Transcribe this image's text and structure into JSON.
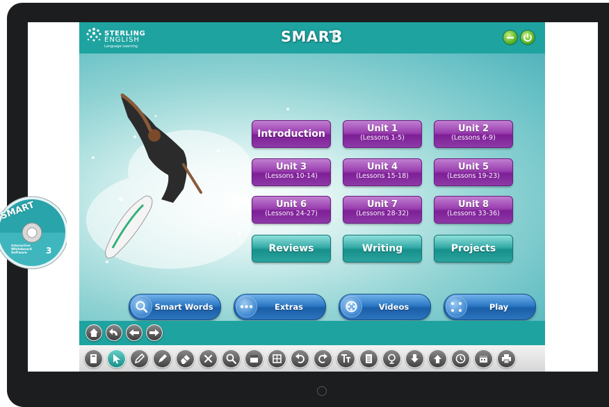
{
  "brand": {
    "name": "STERLING",
    "sub": "ENGLISH",
    "tagline": "Language Learning",
    "title": "SMART",
    "title_number": "3"
  },
  "menu": [
    {
      "title": "Introduction",
      "sub": ""
    },
    {
      "title": "Unit 1",
      "sub": "(Lessons 1-5)"
    },
    {
      "title": "Unit 2",
      "sub": "(Lessons 6-9)"
    },
    {
      "title": "Unit 3",
      "sub": "(Lessons 10-14)"
    },
    {
      "title": "Unit 4",
      "sub": "(Lessons 15-18)"
    },
    {
      "title": "Unit 5",
      "sub": "(Lessons 19-23)"
    },
    {
      "title": "Unit 6",
      "sub": "(Lessons 24-27)"
    },
    {
      "title": "Unit 7",
      "sub": "(Lessons 28-32)"
    },
    {
      "title": "Unit 8",
      "sub": "(Lessons 33-36)"
    },
    {
      "title": "Reviews",
      "sub": ""
    },
    {
      "title": "Writing",
      "sub": ""
    },
    {
      "title": "Projects",
      "sub": ""
    }
  ],
  "pills": [
    {
      "label": "Smart Words",
      "icon": "magnifier-icon"
    },
    {
      "label": "Extras",
      "icon": "dots-icon"
    },
    {
      "label": "Videos",
      "icon": "film-reel-icon"
    },
    {
      "label": "Play",
      "icon": "game-icon"
    }
  ],
  "disc": {
    "label": "SMART",
    "number": "3",
    "caption": "Interactive Whiteboard Software"
  },
  "colors": {
    "teal": "#1ea3a0",
    "purple": "#8d3aa8",
    "blue": "#2c78c4"
  }
}
